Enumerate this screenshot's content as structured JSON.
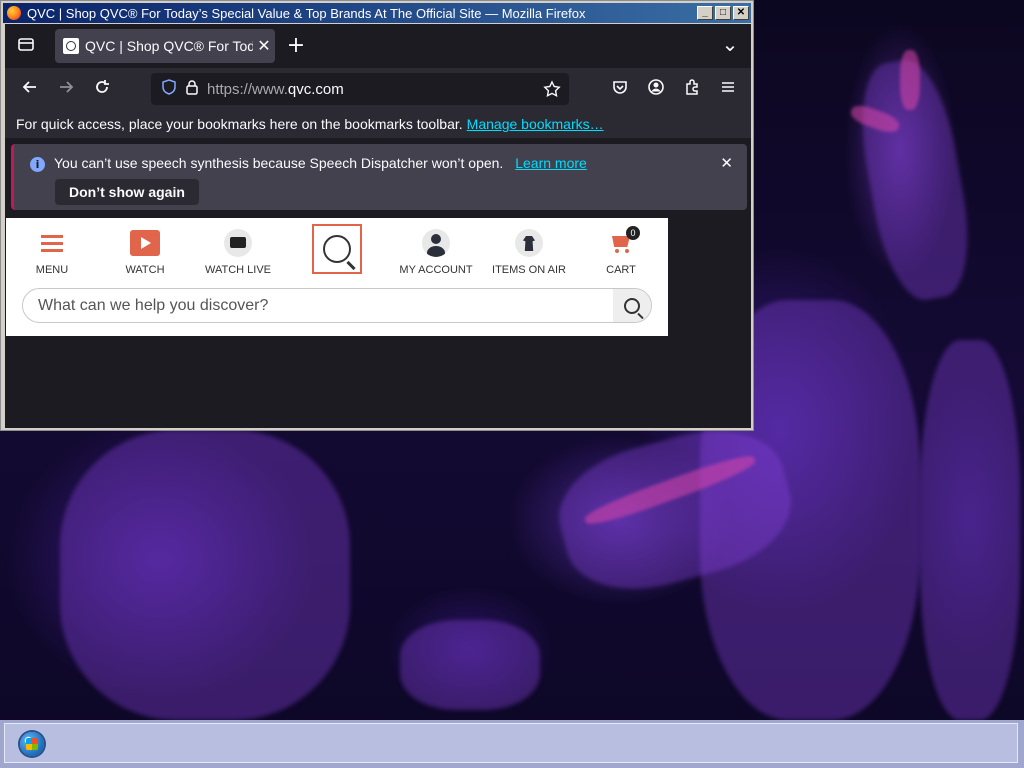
{
  "window": {
    "title": "QVC | Shop QVC® For Today’s Special Value & Top Brands At The Official Site — Mozilla Firefox",
    "controls": [
      "_",
      "□",
      "✕"
    ]
  },
  "browser": {
    "tab": {
      "title": "QVC | Shop QVC® For Today’s Special Value & Top Brands At The Official Site",
      "close": "✕"
    },
    "new_tab": "+",
    "list_tabs": "⌄",
    "url": {
      "prefix": "https://www.",
      "host": "qvc.com"
    },
    "bookmarks_bar": {
      "text": "For quick access, place your bookmarks here on the bookmarks toolbar.",
      "link": "Manage bookmarks…"
    },
    "notification": {
      "message": "You can’t use speech synthesis because Speech Dispatcher won’t open.",
      "link": "Learn more",
      "button": "Don’t show again",
      "close": "✕"
    }
  },
  "page": {
    "nav": {
      "menu": "MENU",
      "watch": "WATCH",
      "watch_live": "WATCH LIVE",
      "my_account": "MY ACCOUNT",
      "items_on_air": "ITEMS ON AIR",
      "cart": "CART",
      "cart_count": "0"
    },
    "search": {
      "placeholder": "What can we help you discover?"
    }
  },
  "colors": {
    "qvc_accent": "#e0654b",
    "link": "#00ddff",
    "browser_dark": "#1c1b22"
  }
}
